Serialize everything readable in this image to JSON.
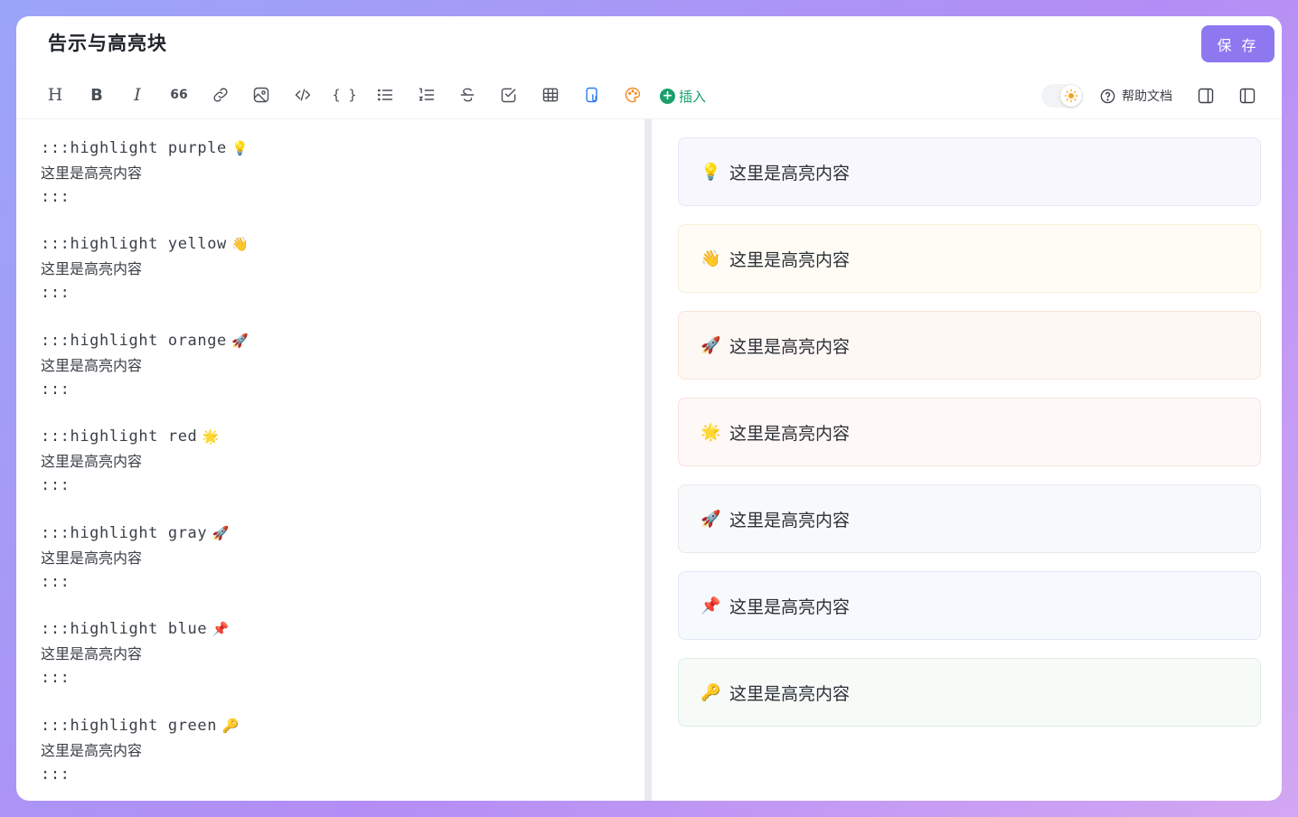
{
  "header": {
    "title": "告示与高亮块",
    "save_label": "保 存"
  },
  "toolbar": {
    "heading_label": "H",
    "bold_label": "B",
    "italic_label": "I",
    "quote_label": "66",
    "code_label": "{ }",
    "insert_label": "插入",
    "help_label": "帮助文档",
    "icons": [
      "heading-icon",
      "bold-icon",
      "italic-icon",
      "quote-icon",
      "link-icon",
      "image-icon",
      "code-inline-icon",
      "code-block-icon",
      "bullet-list-icon",
      "ordered-list-icon",
      "strikethrough-icon",
      "task-list-icon",
      "table-icon",
      "copy-format-icon",
      "color-palette-icon"
    ],
    "accent_color": "#8e78f0",
    "insert_color": "#1aa06a"
  },
  "editor": {
    "blocks": [
      {
        "open": ":::highlight purple",
        "emoji": "💡",
        "body": "这里是高亮内容",
        "close": ":::"
      },
      {
        "open": ":::highlight yellow",
        "emoji": "👋",
        "body": "这里是高亮内容",
        "close": ":::"
      },
      {
        "open": ":::highlight orange",
        "emoji": "🚀",
        "body": "这里是高亮内容",
        "close": ":::"
      },
      {
        "open": ":::highlight red",
        "emoji": "🌟",
        "body": "这里是高亮内容",
        "close": ":::"
      },
      {
        "open": ":::highlight gray",
        "emoji": "🚀",
        "body": "这里是高亮内容",
        "close": ":::"
      },
      {
        "open": ":::highlight blue",
        "emoji": "📌",
        "body": "这里是高亮内容",
        "close": ":::"
      },
      {
        "open": ":::highlight green",
        "emoji": "🔑",
        "body": "这里是高亮内容",
        "close": ":::"
      }
    ]
  },
  "preview": {
    "blocks": [
      {
        "emoji": "💡",
        "text": "这里是高亮内容",
        "bg": "#f8f7fe",
        "border": "#e9e6f8"
      },
      {
        "emoji": "👋",
        "text": "这里是高亮内容",
        "bg": "#fefcf5",
        "border": "#f6efd9"
      },
      {
        "emoji": "🚀",
        "text": "这里是高亮内容",
        "bg": "#fef8f5",
        "border": "#f9e3da"
      },
      {
        "emoji": "🌟",
        "text": "这里是高亮内容",
        "bg": "#fef8f7",
        "border": "#f8e1df"
      },
      {
        "emoji": "🚀",
        "text": "这里是高亮内容",
        "bg": "#f8f9fb",
        "border": "#e8eaef"
      },
      {
        "emoji": "📌",
        "text": "这里是高亮内容",
        "bg": "#f6f9fe",
        "border": "#e1e9f6"
      },
      {
        "emoji": "🔑",
        "text": "这里是高亮内容",
        "bg": "#f6fbf8",
        "border": "#ddeee5"
      }
    ]
  }
}
